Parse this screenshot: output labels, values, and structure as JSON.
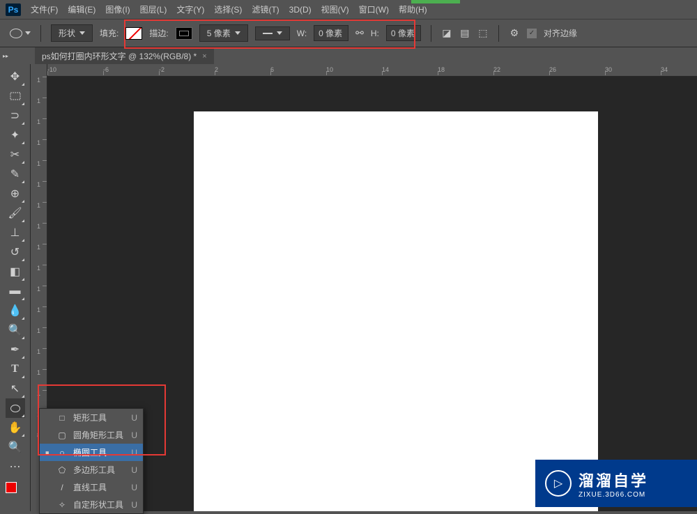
{
  "menu": {
    "file": "文件(F)",
    "edit": "编辑(E)",
    "image": "图像(I)",
    "layer": "图层(L)",
    "type": "文字(Y)",
    "select": "选择(S)",
    "filter": "滤镜(T)",
    "3d": "3D(D)",
    "view": "视图(V)",
    "window": "窗口(W)",
    "help": "帮助(H)"
  },
  "options": {
    "mode": "形状",
    "fill_label": "填充:",
    "stroke_label": "描边:",
    "stroke_width": "5 像素",
    "w_label": "W:",
    "w_val": "0 像素",
    "h_label": "H:",
    "h_val": "0 像素",
    "align_edges": "对齐边缘"
  },
  "tab": {
    "title": "ps如何打圈内环形文字 @ 132%(RGB/8) *",
    "close": "×"
  },
  "ruler_h": [
    "-10",
    "-6",
    "-2",
    "2",
    "6",
    "10",
    "14",
    "18",
    "22",
    "26",
    "30",
    "34"
  ],
  "ruler_h_pos": [
    0,
    80,
    160,
    240,
    320,
    400,
    480,
    560,
    640,
    720,
    800,
    880
  ],
  "ruler_v": [
    "1",
    "1",
    "1",
    "1",
    "1",
    "1",
    "1",
    "1",
    "1",
    "1",
    "1",
    "1",
    "1",
    "1",
    "1",
    "1",
    "1",
    "8"
  ],
  "ruler_v_pos": [
    18,
    48,
    78,
    108,
    138,
    168,
    198,
    228,
    258,
    288,
    318,
    348,
    378,
    408,
    438,
    468,
    498,
    528
  ],
  "flyout": {
    "items": [
      {
        "icon": "□",
        "label": "矩形工具",
        "key": "U"
      },
      {
        "icon": "▢",
        "label": "圆角矩形工具",
        "key": "U"
      },
      {
        "icon": "○",
        "label": "椭圆工具",
        "key": "U"
      },
      {
        "icon": "⬠",
        "label": "多边形工具",
        "key": "U"
      },
      {
        "icon": "/",
        "label": "直线工具",
        "key": "U"
      },
      {
        "icon": "✧",
        "label": "自定形状工具",
        "key": "U"
      }
    ],
    "selected": 2
  },
  "watermark": {
    "main": "溜溜自学",
    "sub": "ZIXUE.3D66.COM",
    "play": "▷"
  },
  "logo": "Ps"
}
